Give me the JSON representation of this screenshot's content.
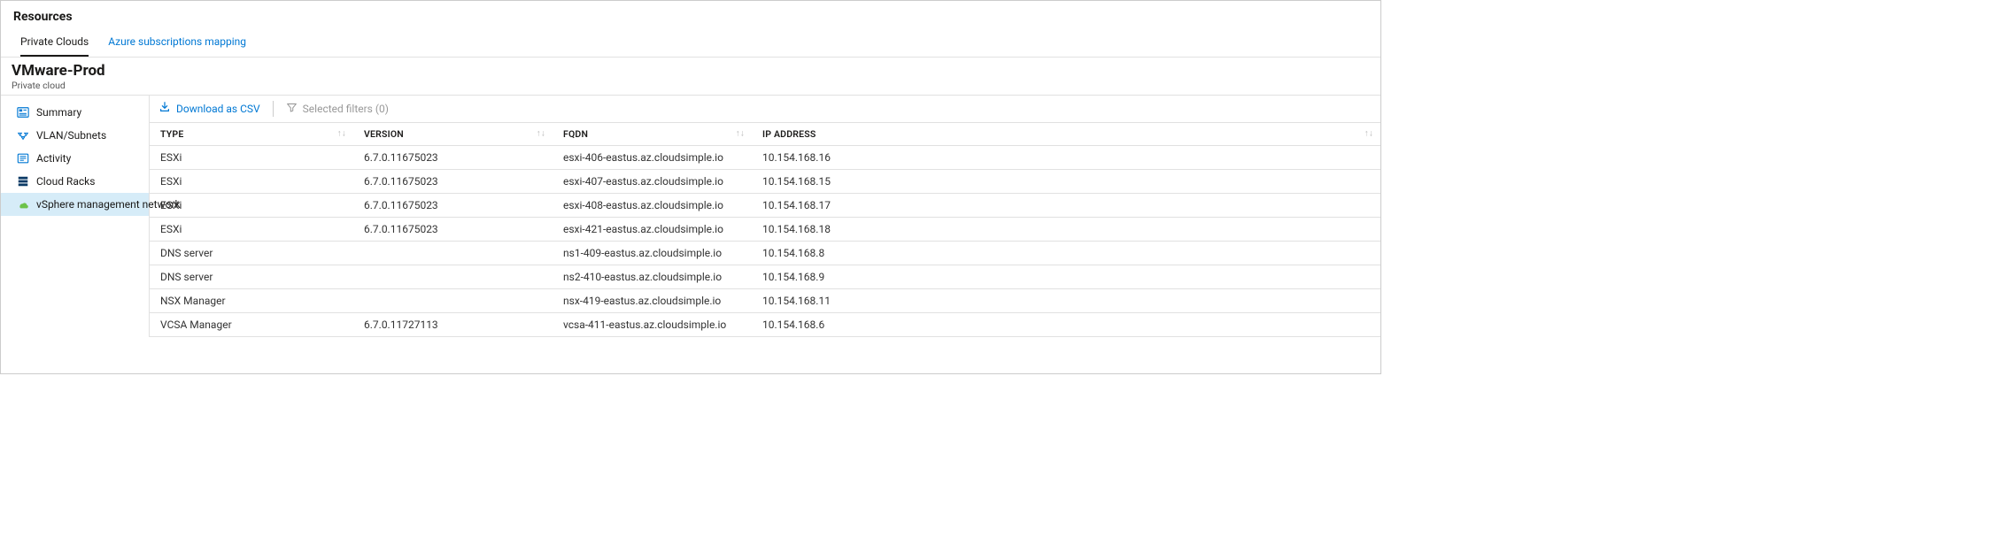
{
  "page_title": "Resources",
  "tabs": [
    {
      "label": "Private Clouds",
      "active": true
    },
    {
      "label": "Azure subscriptions mapping",
      "active": false
    }
  ],
  "resource": {
    "name": "VMware-Prod",
    "type": "Private cloud"
  },
  "sidebar": {
    "items": [
      {
        "label": "Summary",
        "icon": "summary-icon",
        "active": false
      },
      {
        "label": "VLAN/Subnets",
        "icon": "vlan-icon",
        "active": false
      },
      {
        "label": "Activity",
        "icon": "activity-icon",
        "active": false
      },
      {
        "label": "Cloud Racks",
        "icon": "racks-icon",
        "active": false
      },
      {
        "label": "vSphere management network",
        "icon": "network-icon",
        "active": true
      }
    ]
  },
  "toolbar": {
    "download_label": "Download as CSV",
    "filter_label": "Selected filters (0)"
  },
  "table": {
    "headers": {
      "type": "TYPE",
      "version": "VERSION",
      "fqdn": "FQDN",
      "ip": "IP ADDRESS"
    },
    "rows": [
      {
        "type": "ESXi",
        "version": "6.7.0.11675023",
        "fqdn": "esxi-406-eastus.az.cloudsimple.io",
        "ip": "10.154.168.16"
      },
      {
        "type": "ESXi",
        "version": "6.7.0.11675023",
        "fqdn": "esxi-407-eastus.az.cloudsimple.io",
        "ip": "10.154.168.15"
      },
      {
        "type": "ESXi",
        "version": "6.7.0.11675023",
        "fqdn": "esxi-408-eastus.az.cloudsimple.io",
        "ip": "10.154.168.17"
      },
      {
        "type": "ESXi",
        "version": "6.7.0.11675023",
        "fqdn": "esxi-421-eastus.az.cloudsimple.io",
        "ip": "10.154.168.18"
      },
      {
        "type": "DNS server",
        "version": "",
        "fqdn": "ns1-409-eastus.az.cloudsimple.io",
        "ip": "10.154.168.8"
      },
      {
        "type": "DNS server",
        "version": "",
        "fqdn": "ns2-410-eastus.az.cloudsimple.io",
        "ip": "10.154.168.9"
      },
      {
        "type": "NSX Manager",
        "version": "",
        "fqdn": "nsx-419-eastus.az.cloudsimple.io",
        "ip": "10.154.168.11"
      },
      {
        "type": "VCSA Manager",
        "version": "6.7.0.11727113",
        "fqdn": "vcsa-411-eastus.az.cloudsimple.io",
        "ip": "10.154.168.6"
      }
    ]
  }
}
